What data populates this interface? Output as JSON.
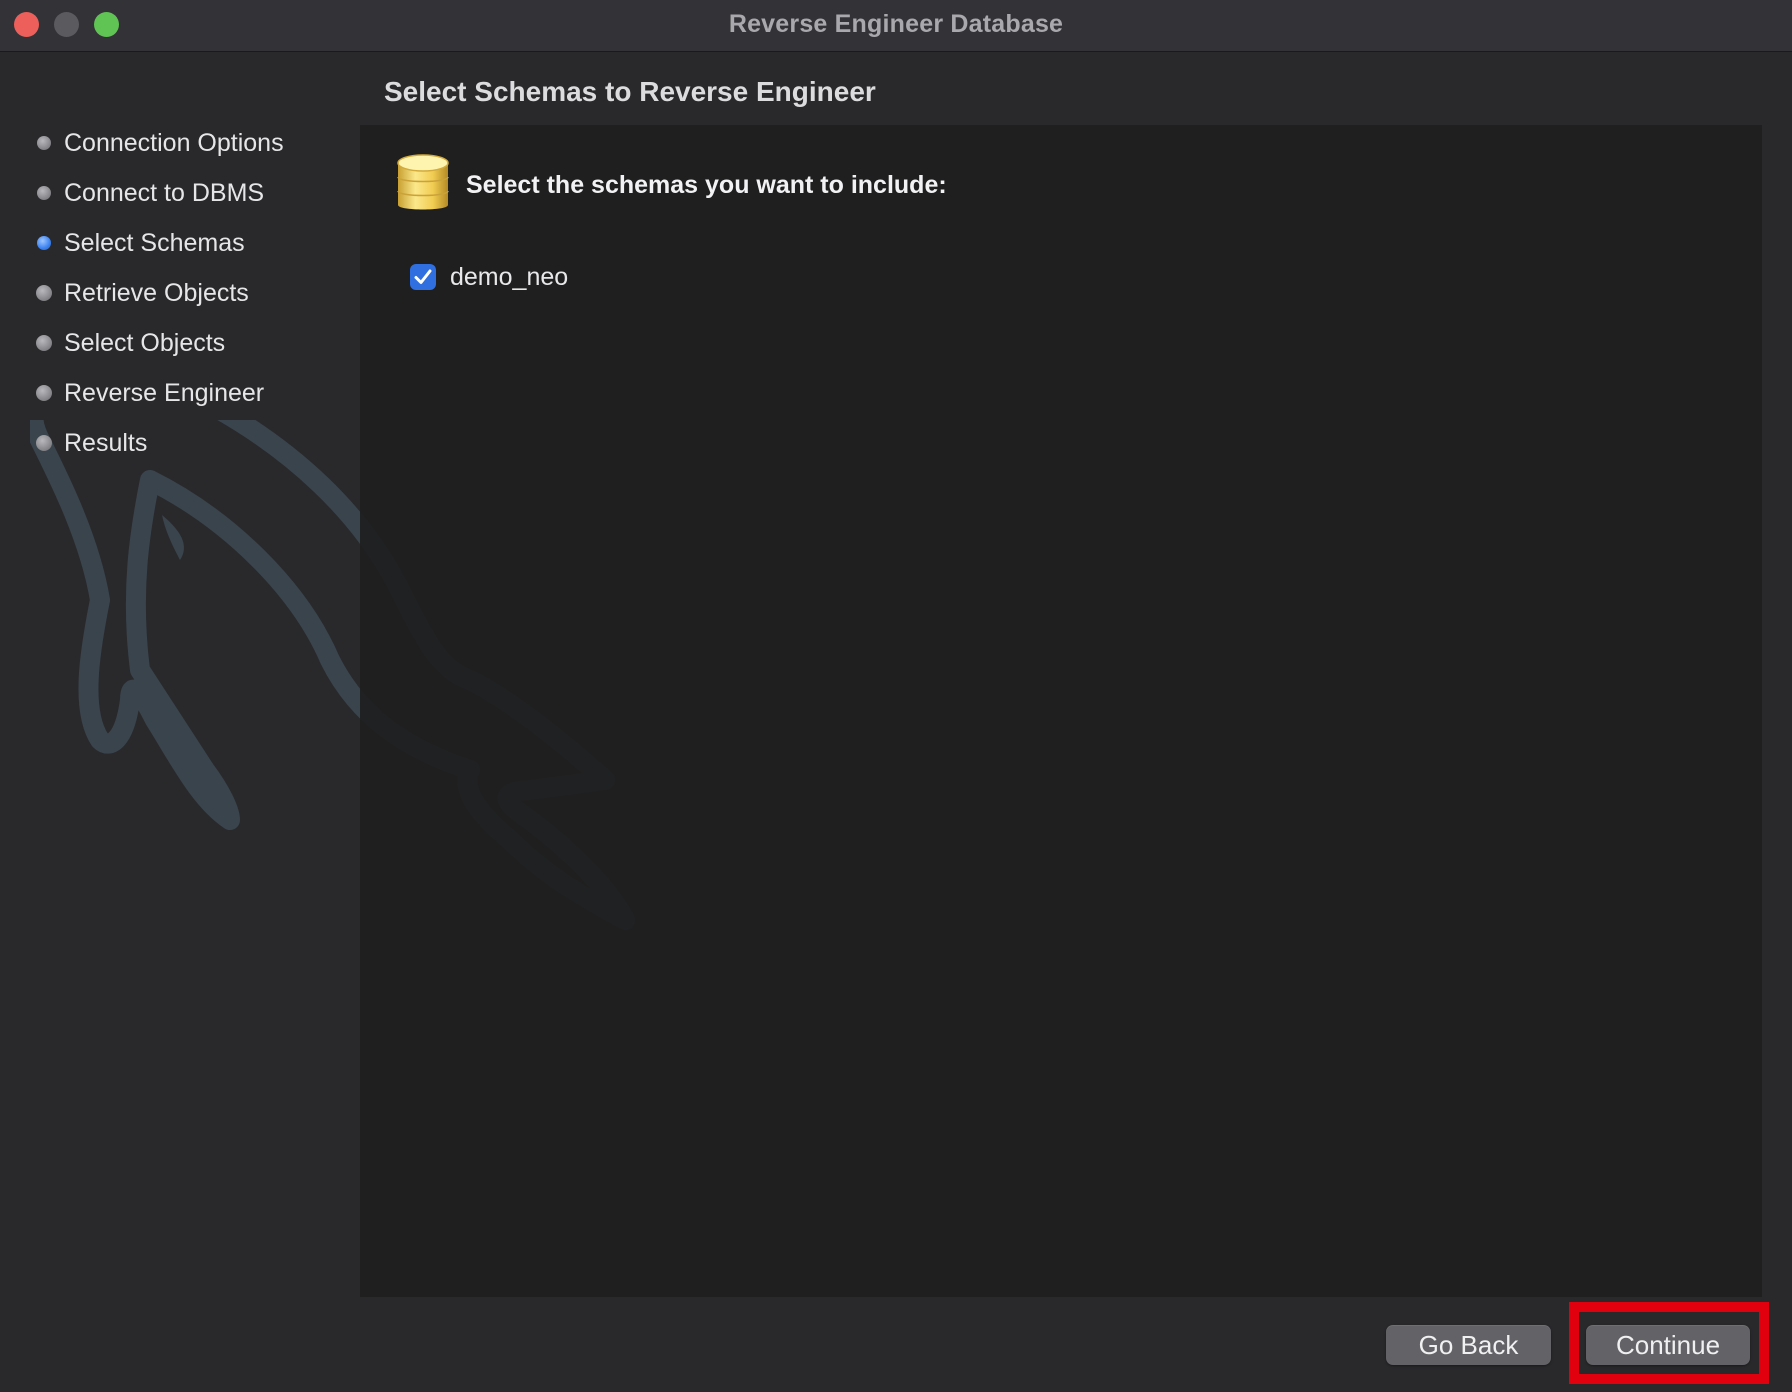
{
  "window": {
    "title": "Reverse Engineer Database"
  },
  "sidebar": {
    "steps": [
      {
        "label": "Connection Options",
        "state": "done"
      },
      {
        "label": "Connect to DBMS",
        "state": "done"
      },
      {
        "label": "Select Schemas",
        "state": "active"
      },
      {
        "label": "Retrieve Objects",
        "state": "pending"
      },
      {
        "label": "Select Objects",
        "state": "pending"
      },
      {
        "label": "Reverse Engineer",
        "state": "pending"
      },
      {
        "label": "Results",
        "state": "pending"
      }
    ]
  },
  "main": {
    "heading": "Select Schemas to Reverse Engineer",
    "prompt": "Select the schemas you want to include:",
    "icon": "database-icon",
    "schemas": [
      {
        "name": "demo_neo",
        "checked": true
      }
    ]
  },
  "footer": {
    "back_label": "Go Back",
    "continue_label": "Continue",
    "highlight_color": "#e0000e"
  }
}
